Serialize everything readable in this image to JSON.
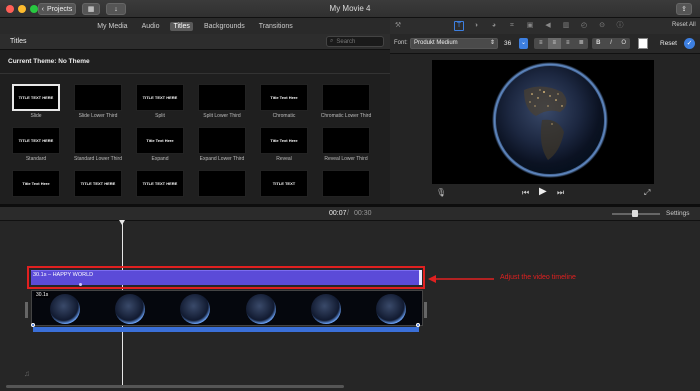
{
  "window": {
    "title": "My Movie 4",
    "back_label": "Projects",
    "share_label": ""
  },
  "tabs": [
    {
      "label": "My Media",
      "active": false
    },
    {
      "label": "Audio",
      "active": false
    },
    {
      "label": "Titles",
      "active": true
    },
    {
      "label": "Backgrounds",
      "active": false
    },
    {
      "label": "Transitions",
      "active": false
    }
  ],
  "browser": {
    "section_title": "Titles",
    "search_placeholder": "Search",
    "current_theme": "Current Theme: No Theme",
    "tiles": [
      {
        "label": "Slide",
        "thumb_text": "TITLE TEXT HERE"
      },
      {
        "label": "Slide Lower Third",
        "thumb_text": ""
      },
      {
        "label": "Split",
        "thumb_text": "TITLE TEXT HERE"
      },
      {
        "label": "Split Lower Third",
        "thumb_text": ""
      },
      {
        "label": "Chromatic",
        "thumb_text": "Title Text Here"
      },
      {
        "label": "Chromatic Lower Third",
        "thumb_text": ""
      },
      {
        "label": "Standard",
        "thumb_text": "TITLE TEXT HERE"
      },
      {
        "label": "Standard Lower Third",
        "thumb_text": ""
      },
      {
        "label": "Expand",
        "thumb_text": "Title Text Here"
      },
      {
        "label": "Expand Lower Third",
        "thumb_text": ""
      },
      {
        "label": "Reveal",
        "thumb_text": "Title Text Here"
      },
      {
        "label": "Reveal Lower Third",
        "thumb_text": ""
      },
      {
        "label": "",
        "thumb_text": "Title Text Here"
      },
      {
        "label": "",
        "thumb_text": "TITLE TEXT HERE"
      },
      {
        "label": "",
        "thumb_text": "TITLE TEXT HERE"
      },
      {
        "label": "",
        "thumb_text": ""
      },
      {
        "label": "",
        "thumb_text": "TITLE TEXT"
      },
      {
        "label": "",
        "thumb_text": ""
      }
    ]
  },
  "viewer": {
    "reset_all_label": "Reset All",
    "font_label": "Font:",
    "font_name": "Produkt Medium",
    "font_size": "36",
    "reset_label": "Reset",
    "text_color": "#ffffff"
  },
  "timebar": {
    "current": "00:07",
    "separator": "/",
    "total": "00:30",
    "settings_label": "Settings"
  },
  "timeline": {
    "title_clip_label": "30.1s – HAPPY WORLD",
    "video_clip_badge": "30.1s",
    "annotation": "Adjust the video timeline",
    "annotation_color": "#e02020",
    "title_clip_color": "#5b4bd8",
    "audio_bar_color": "#3a6fd8"
  },
  "colors": {
    "accent": "#3d7fe0",
    "highlight": "#e02020"
  }
}
